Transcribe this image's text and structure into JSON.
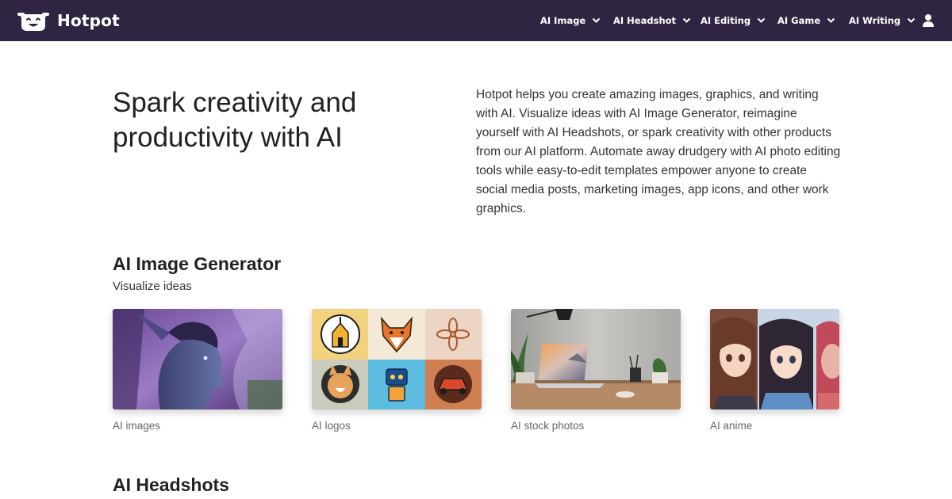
{
  "brand": {
    "name": "Hotpot",
    "logo_icon": "smiling-pot-icon"
  },
  "nav": {
    "items": [
      {
        "label": "AI Image"
      },
      {
        "label": "AI Headshot"
      },
      {
        "label": "AI Editing"
      },
      {
        "label": "AI Game"
      },
      {
        "label": "AI Writing"
      }
    ],
    "dropdown_icon": "chevron-down-icon",
    "user_icon": "user-icon"
  },
  "hero": {
    "title": "Spark creativity and productivity with AI",
    "description": "Hotpot helps you create amazing images, graphics, and writing with AI. Visualize ideas with AI Image Generator, reimagine yourself with AI Headshots, or spark creativity with other products from our AI platform. Automate away drudgery with AI photo editing tools while easy-to-edit templates empower anyone to create social media posts, marketing images, app icons, and other work graphics."
  },
  "sections": [
    {
      "title": "AI Image Generator",
      "subtitle": "Visualize ideas",
      "cards": [
        {
          "label": "AI images"
        },
        {
          "label": "AI logos"
        },
        {
          "label": "AI stock photos"
        },
        {
          "label": "AI anime"
        }
      ]
    },
    {
      "title": "AI Headshots"
    }
  ],
  "colors": {
    "navbar_bg": "#2f2542",
    "nav_text": "#ffffff",
    "text": "#222222",
    "muted": "#666666"
  }
}
